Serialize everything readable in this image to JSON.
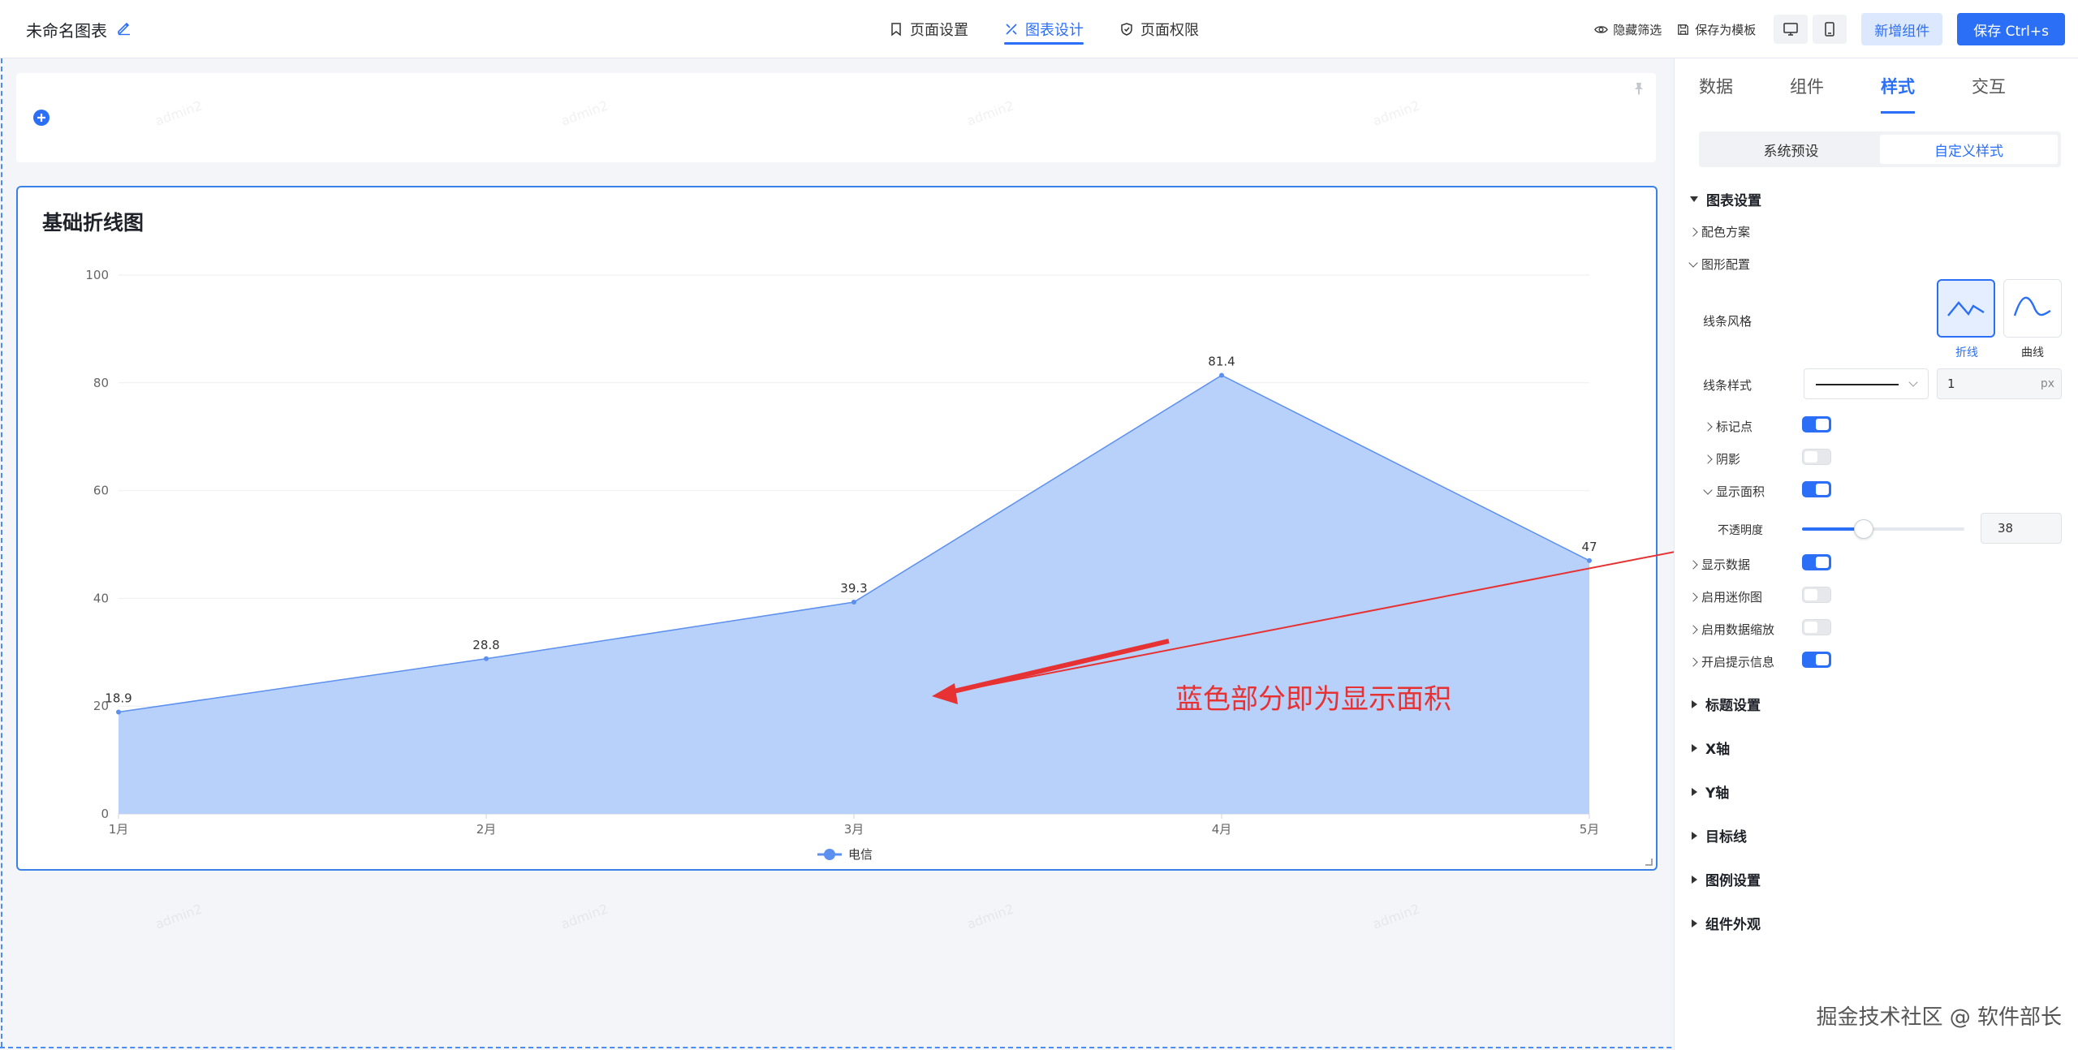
{
  "header": {
    "doc_title": "未命名图表",
    "tabs": [
      {
        "label": "页面设置",
        "icon": "bookmark-icon"
      },
      {
        "label": "图表设计",
        "icon": "design-icon"
      },
      {
        "label": "页面权限",
        "icon": "shield-icon"
      }
    ],
    "active_tab": "图表设计",
    "hide_filter": "隐藏筛选",
    "save_template": "保存为模板",
    "add_component": "新增组件",
    "save": "保存 Ctrl+s"
  },
  "chart_card": {
    "title": "基础折线图"
  },
  "chart_data": {
    "type": "area",
    "categories": [
      "1月",
      "2月",
      "3月",
      "4月",
      "5月"
    ],
    "series": [
      {
        "name": "电信",
        "values": [
          18.9,
          28.8,
          39.3,
          81.4,
          47
        ]
      }
    ],
    "title": "基础折线图",
    "ylim": [
      0,
      100
    ],
    "yticks": [
      0,
      20,
      40,
      60,
      80,
      100
    ],
    "grid": true,
    "legend": "bottom-center",
    "data_labels": true,
    "area_color": "#b8d1fa",
    "line_color": "#5b8ff0"
  },
  "annotation": {
    "text": "蓝色部分即为显示面积",
    "color": "#e63232"
  },
  "panel": {
    "tabs": [
      "数据",
      "组件",
      "样式",
      "交互"
    ],
    "active_tab": "样式",
    "segment": [
      "系统预设",
      "自定义样式"
    ],
    "active_segment": "自定义样式",
    "chart_settings": "图表设置",
    "color_scheme": "配色方案",
    "shape_config": "图形配置",
    "line_style_label": "线条风格",
    "style_options": [
      "折线",
      "曲线"
    ],
    "active_style": "折线",
    "line_type_label": "线条样式",
    "line_width": "1",
    "line_width_unit": "px",
    "marker": "标记点",
    "shadow": "阴影",
    "show_area": "显示面积",
    "opacity_label": "不透明度",
    "opacity_value": "38",
    "opacity_fraction": 0.38,
    "show_data": "显示数据",
    "mini_chart": "启用迷你图",
    "data_zoom": "启用数据缩放",
    "tooltip": "开启提示信息",
    "sections": [
      "标题设置",
      "X轴",
      "Y轴",
      "目标线",
      "图例设置",
      "组件外观"
    ]
  },
  "watermark": "掘金技术社区 @ 软件部长",
  "bg_watermark": "admin2"
}
